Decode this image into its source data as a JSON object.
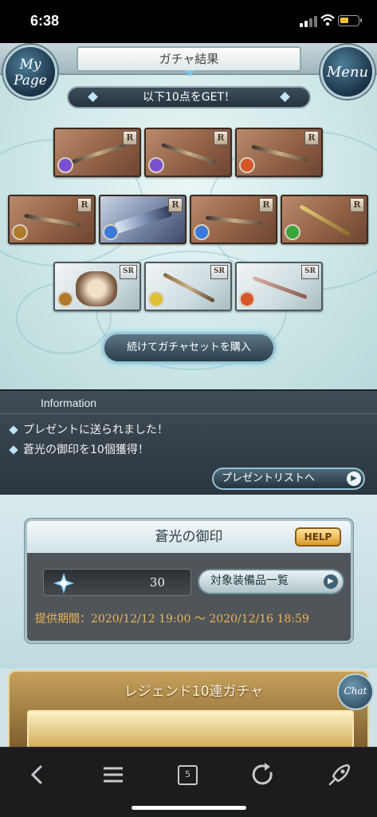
{
  "status_bar": {
    "time": "6:38",
    "battery_color": "#f4c42a"
  },
  "header": {
    "title": "ガチャ結果",
    "mypage_label": "My Page",
    "menu_label": "Menu"
  },
  "result": {
    "banner": "以下10点をGET！",
    "items": [
      {
        "rarity": "R",
        "element": "dark",
        "element_color": "#7b4fd0"
      },
      {
        "rarity": "R",
        "element": "dark",
        "element_color": "#7b4fd0"
      },
      {
        "rarity": "R",
        "element": "fire",
        "element_color": "#d9552a"
      },
      {
        "rarity": "R",
        "element": "earth",
        "element_color": "#b07a2a"
      },
      {
        "rarity": "R",
        "element": "water",
        "element_color": "#3b7ad8"
      },
      {
        "rarity": "R",
        "element": "water",
        "element_color": "#3b7ad8"
      },
      {
        "rarity": "R",
        "element": "wind",
        "element_color": "#3aa63a"
      },
      {
        "rarity": "SR",
        "element": "earth",
        "element_color": "#b07a2a"
      },
      {
        "rarity": "SR",
        "element": "light",
        "element_color": "#e0c030"
      },
      {
        "rarity": "SR",
        "element": "fire",
        "element_color": "#d9552a"
      }
    ],
    "buy_button": "続けてガチャセットを購入"
  },
  "information": {
    "title": "Information",
    "messages": [
      "プレゼントに送られました！",
      "蒼光の御印を10個獲得！"
    ],
    "present_button": "プレゼントリストへ"
  },
  "seal": {
    "title": "蒼光の御印",
    "help_label": "HELP",
    "count": "30",
    "equip_button": "対象装備品一覧",
    "period": "提供期間：2020/12/12 19:00 〜 2020/12/16 18:59"
  },
  "legend": {
    "title": "レジェンド10連ガチャ",
    "chat_label": "Chat"
  },
  "browser_bar": {
    "tab_count": "5"
  }
}
